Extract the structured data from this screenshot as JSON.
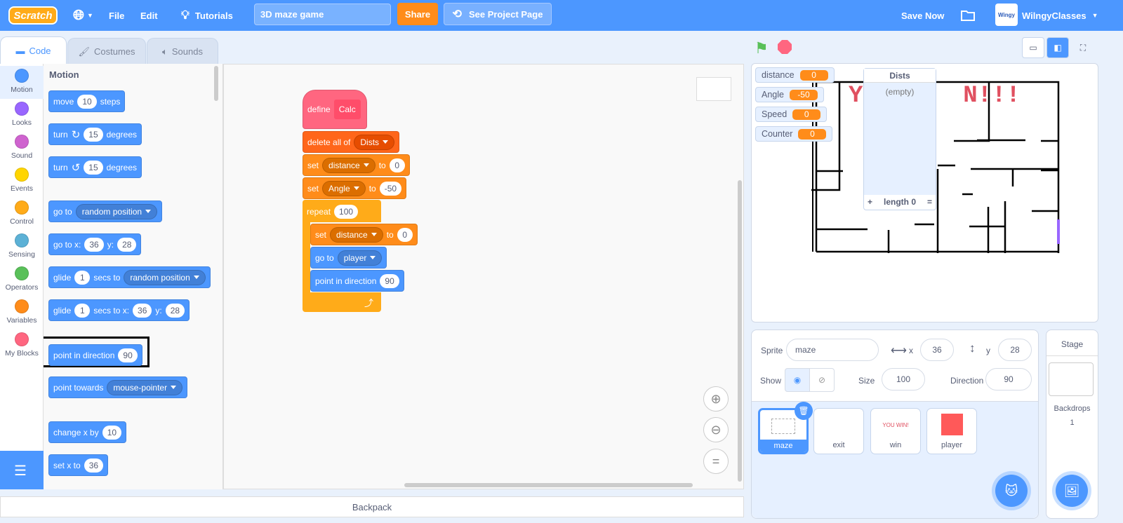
{
  "topbar": {
    "logo": "Scratch",
    "menu_file": "File",
    "menu_edit": "Edit",
    "tutorials": "Tutorials",
    "project_title": "3D maze game",
    "share": "Share",
    "see_project_page": "See Project Page",
    "save_now": "Save Now",
    "username": "WilngyClasses",
    "avatar_text": "Wingy"
  },
  "tabs": [
    {
      "label": "Code"
    },
    {
      "label": "Costumes"
    },
    {
      "label": "Sounds"
    }
  ],
  "categories": [
    {
      "label": "Motion",
      "color": "#4c97ff"
    },
    {
      "label": "Looks",
      "color": "#9966ff"
    },
    {
      "label": "Sound",
      "color": "#cf63cf"
    },
    {
      "label": "Events",
      "color": "#ffd500"
    },
    {
      "label": "Control",
      "color": "#ffab19"
    },
    {
      "label": "Sensing",
      "color": "#5cb1d6"
    },
    {
      "label": "Operators",
      "color": "#59c059"
    },
    {
      "label": "Variables",
      "color": "#ff8c1a"
    },
    {
      "label": "My Blocks",
      "color": "#ff6680"
    }
  ],
  "palette": {
    "heading": "Motion",
    "blocks": [
      [
        {
          "t": "move"
        },
        {
          "i": "10"
        },
        {
          "t": "steps"
        }
      ],
      [
        {
          "t": "turn"
        },
        {
          "ic": "↻"
        },
        {
          "i": "15"
        },
        {
          "t": "degrees"
        }
      ],
      [
        {
          "t": "turn"
        },
        {
          "ic": "↺"
        },
        {
          "i": "15"
        },
        {
          "t": "degrees"
        }
      ],
      [
        {
          "t": "go to"
        },
        {
          "d": "random position"
        }
      ],
      [
        {
          "t": "go to x:"
        },
        {
          "i": "36"
        },
        {
          "t": "y:"
        },
        {
          "i": "28"
        }
      ],
      [
        {
          "t": "glide"
        },
        {
          "i": "1"
        },
        {
          "t": "secs to"
        },
        {
          "d": "random position"
        }
      ],
      [
        {
          "t": "glide"
        },
        {
          "i": "1"
        },
        {
          "t": "secs to x:"
        },
        {
          "i": "36"
        },
        {
          "t": "y:"
        },
        {
          "i": "28"
        }
      ],
      [
        {
          "t": "point in direction"
        },
        {
          "i": "90"
        }
      ],
      [
        {
          "t": "point towards"
        },
        {
          "d": "mouse-pointer"
        }
      ],
      [
        {
          "t": "change x by"
        },
        {
          "i": "10"
        }
      ],
      [
        {
          "t": "set x to"
        },
        {
          "i": "36"
        }
      ]
    ]
  },
  "script": {
    "blocks": [
      [
        {
          "t": "define"
        },
        {
          "i": "Calc"
        }
      ],
      [
        {
          "t": "delete all of"
        },
        {
          "d": "Dists"
        }
      ],
      [
        {
          "t": "set"
        },
        {
          "d": "distance"
        },
        {
          "t": "to"
        },
        {
          "i": "0"
        }
      ],
      [
        {
          "t": "set"
        },
        {
          "d": "Angle"
        },
        {
          "t": "to"
        },
        {
          "i": "-50"
        }
      ],
      [
        {
          "t": "repeat"
        },
        {
          "i": "100"
        }
      ],
      [
        {
          "t": "set"
        },
        {
          "d": "distance"
        },
        {
          "t": "to"
        },
        {
          "i": "0"
        }
      ],
      [
        {
          "t": "go to"
        },
        {
          "d": "player"
        }
      ],
      [
        {
          "t": "point in direction"
        },
        {
          "i": "90"
        }
      ]
    ]
  },
  "backpack": "Backpack",
  "stage": {
    "monitors": [
      {
        "name": "distance",
        "value": "0"
      },
      {
        "name": "Angle",
        "value": "-50"
      },
      {
        "name": "Speed",
        "value": "0"
      },
      {
        "name": "Counter",
        "value": "0"
      }
    ],
    "list": {
      "title": "Dists",
      "empty": "(empty)",
      "add": "+",
      "length": "length 0",
      "resize": "="
    },
    "banner_text": "Y       N!!!"
  },
  "sprite_info": {
    "sprite_label": "Sprite",
    "sprite_name": "maze",
    "x_label": "x",
    "x": "36",
    "y_label": "y",
    "y": "28",
    "show_label": "Show",
    "size_label": "Size",
    "size": "100",
    "direction_label": "Direction",
    "direction": "90"
  },
  "sprites": [
    {
      "name": "maze",
      "selected": true
    },
    {
      "name": "exit"
    },
    {
      "name": "win",
      "thumb_text": "YOU WIN!"
    },
    {
      "name": "player",
      "color": "#ff5959"
    }
  ],
  "stage_panel": {
    "title": "Stage",
    "backdrops_label": "Backdrops",
    "backdrops_count": "1"
  }
}
